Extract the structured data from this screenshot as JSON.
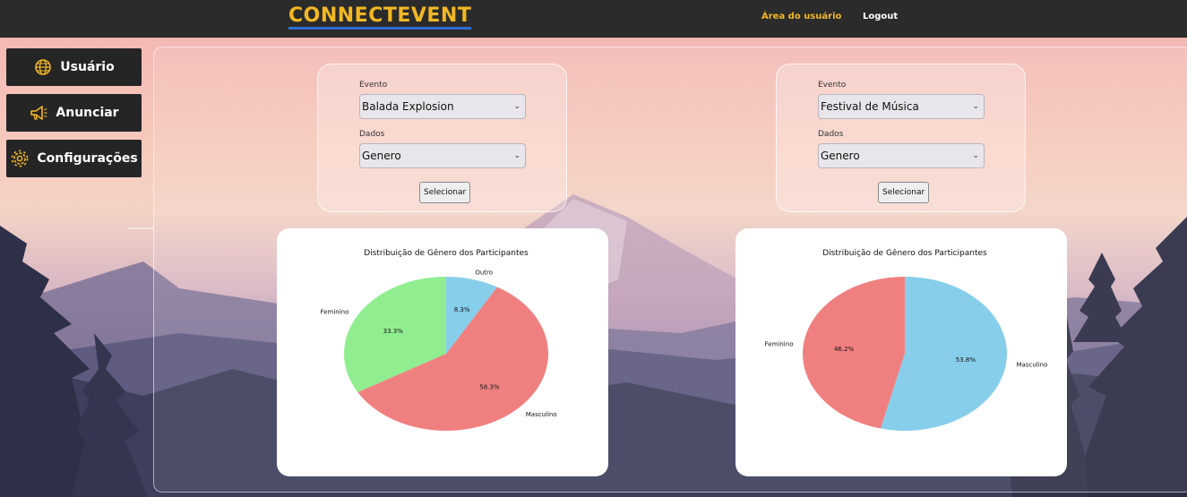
{
  "header": {
    "brand": "CONNECTEVENT",
    "nav_user": "Área do usuário",
    "nav_logout": "Logout"
  },
  "sidebar": {
    "items": [
      {
        "label": "Usuário",
        "icon": "globe-icon"
      },
      {
        "label": "Anunciar",
        "icon": "megaphone-icon"
      },
      {
        "label": "Configurações",
        "icon": "gear-icon"
      }
    ]
  },
  "forms": [
    {
      "event_label": "Evento",
      "event_value": "Balada Explosion",
      "data_label": "Dados",
      "data_value": "Genero",
      "button": "Selecionar"
    },
    {
      "event_label": "Evento",
      "event_value": "Festival de Música",
      "data_label": "Dados",
      "data_value": "Genero",
      "button": "Selecionar"
    }
  ],
  "colors": {
    "accent": "#f2b824",
    "brand_underline": "#2d6fd1",
    "topbar": "#2b2b2b",
    "sidebar_button": "#252525",
    "feminino": "#f08080",
    "masculino": "#87ceeb",
    "outro": "#90ee90"
  },
  "chart_data": [
    {
      "type": "pie",
      "title": "Distribuição de Gênero dos Participantes",
      "slices": [
        {
          "label": "Feminino",
          "value": 33.3,
          "pct_label": "33.3%",
          "color": "#90ee90"
        },
        {
          "label": "Masculino",
          "value": 58.3,
          "pct_label": "58.3%",
          "color": "#f08080"
        },
        {
          "label": "Outro",
          "value": 8.3,
          "pct_label": "8.3%",
          "color": "#87ceeb"
        }
      ]
    },
    {
      "type": "pie",
      "title": "Distribuição de Gênero dos Participantes",
      "slices": [
        {
          "label": "Feminino",
          "value": 46.2,
          "pct_label": "46.2%",
          "color": "#f08080"
        },
        {
          "label": "Masculino",
          "value": 53.8,
          "pct_label": "53.8%",
          "color": "#87ceeb"
        }
      ]
    }
  ]
}
